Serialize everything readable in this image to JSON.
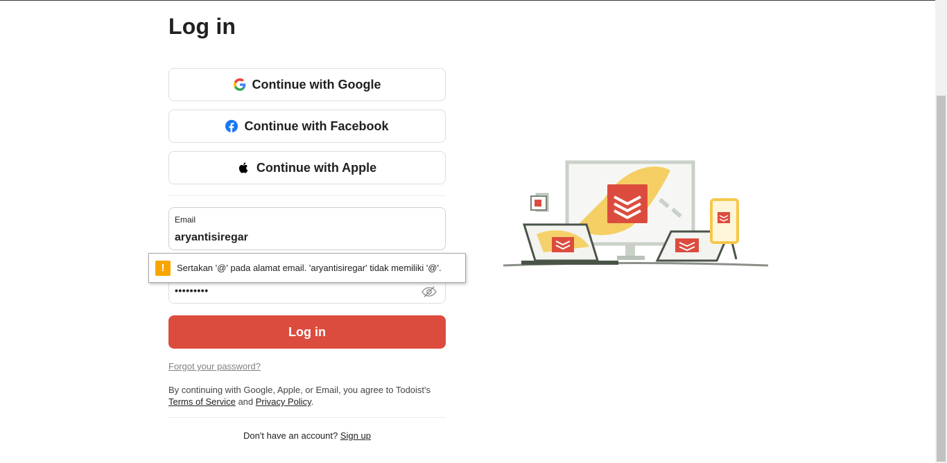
{
  "page": {
    "title": "Log in"
  },
  "social": {
    "google_label": "Continue with Google",
    "facebook_label": "Continue with Facebook",
    "apple_label": "Continue with Apple"
  },
  "email": {
    "label": "Email",
    "value": "aryantisiregar"
  },
  "password": {
    "masked_value": "•••••••••"
  },
  "validation": {
    "icon": "!",
    "message": "Sertakan '@' pada alamat email. 'aryantisiregar' tidak memiliki '@'."
  },
  "login_button": {
    "label": "Log in"
  },
  "forgot_password": {
    "label": "Forgot your password?"
  },
  "terms": {
    "prefix": "By continuing with Google, Apple, or Email, you agree to Todoist's",
    "terms_label": "Terms of Service",
    "conjunction": "and",
    "privacy_label": "Privacy Policy",
    "suffix": "."
  },
  "signup": {
    "prompt": "Don't have an account?",
    "link_label": "Sign up"
  },
  "colors": {
    "brand_red": "#dc4c3e",
    "warning_orange": "#f7a600",
    "facebook_blue": "#1877f2"
  },
  "icons": [
    "google-icon",
    "facebook-icon",
    "apple-icon",
    "eye-off-icon",
    "warning-icon"
  ]
}
